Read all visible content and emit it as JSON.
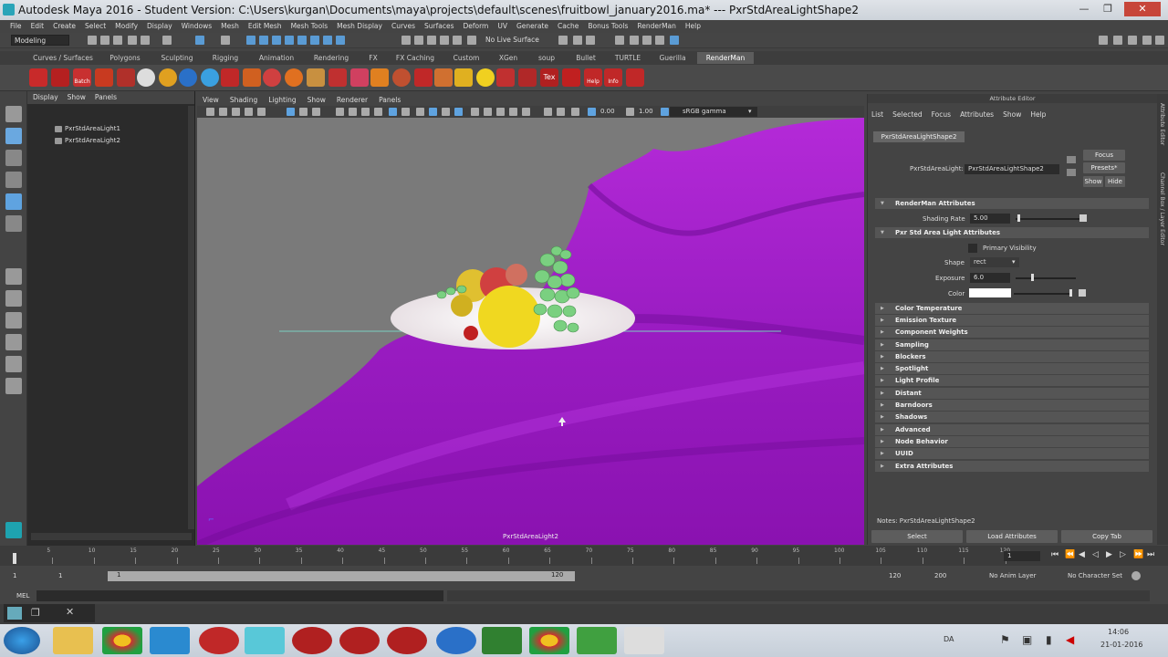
{
  "window": {
    "title": "Autodesk Maya 2016 - Student Version: C:\\Users\\kurgan\\Documents\\maya\\projects\\default\\scenes\\fruitbowl_january2016.ma*   ---   PxrStdAreaLightShape2",
    "minimize": "—",
    "restore": "❐",
    "close": "✕"
  },
  "menubar": [
    "File",
    "Edit",
    "Create",
    "Select",
    "Modify",
    "Display",
    "Windows",
    "Mesh",
    "Edit Mesh",
    "Mesh Tools",
    "Mesh Display",
    "Curves",
    "Surfaces",
    "Deform",
    "UV",
    "Generate",
    "Cache",
    "Bonus Tools",
    "RenderMan",
    "Help"
  ],
  "status": {
    "mode": "Modeling",
    "live_surface": "No Live Surface"
  },
  "shelf_tabs": [
    "Curves / Surfaces",
    "Polygons",
    "Sculpting",
    "Rigging",
    "Animation",
    "Rendering",
    "FX",
    "FX Caching",
    "Custom",
    "XGen",
    "soup",
    "Bullet",
    "TURTLE",
    "Guerilla",
    "RenderMan"
  ],
  "shelf_labels": {
    "batch": "Batch",
    "tex": "Tex",
    "help": "Help",
    "info": "Info"
  },
  "outliner": {
    "menu": [
      "Display",
      "Show",
      "Panels"
    ],
    "items": [
      "PxrStdAreaLight1",
      "PxrStdAreaLight2"
    ]
  },
  "viewport": {
    "menu": [
      "View",
      "Shading",
      "Lighting",
      "Show",
      "Renderer",
      "Panels"
    ],
    "exposure": "0.00",
    "gamma_value": "1.00",
    "colorspace": "sRGB gamma",
    "camera_label": "PxrStdAreaLight2"
  },
  "attribute_editor": {
    "title": "Attribute Editor",
    "menu": [
      "List",
      "Selected",
      "Focus",
      "Attributes",
      "Show",
      "Help"
    ],
    "node_tab": "PxrStdAreaLightShape2",
    "node_label": "PxrStdAreaLight:",
    "node_value": "PxrStdAreaLightShape2",
    "focus": "Focus",
    "presets": "Presets*",
    "show": "Show",
    "hide": "Hide",
    "renderman_section": "RenderMan Attributes",
    "shading_rate_label": "Shading Rate",
    "shading_rate": "5.00",
    "area_section": "Pxr  Std  Area  Light Attributes",
    "primary_visibility": "Primary Visibility",
    "shape_label": "Shape",
    "shape_value": "rect",
    "exposure_label": "Exposure",
    "exposure_value": "6.0",
    "color_label": "Color",
    "sections": [
      "Color Temperature",
      "Emission Texture",
      "Component Weights",
      "Sampling",
      "Blockers",
      "Spotlight",
      "Light Profile",
      "Distant",
      "Barndoors",
      "Shadows",
      "Advanced",
      "Node Behavior",
      "UUID",
      "Extra Attributes"
    ],
    "notes": "Notes:  PxrStdAreaLightShape2",
    "select": "Select",
    "load_attributes": "Load Attributes",
    "copy_tab": "Copy Tab"
  },
  "right_strip": {
    "attr": "Attribute Editor",
    "channel": "Channel Box / Layer Editor"
  },
  "timeline": {
    "ticks": [
      "5",
      "10",
      "15",
      "20",
      "25",
      "30",
      "35",
      "40",
      "45",
      "50",
      "55",
      "60",
      "65",
      "70",
      "75",
      "80",
      "85",
      "90",
      "95",
      "100",
      "105",
      "110",
      "115",
      "120"
    ],
    "current": "1"
  },
  "range": {
    "start": "1",
    "start2": "1",
    "inner_start": "1",
    "inner_end": "120",
    "end": "120",
    "end2": "200",
    "anim_layer": "No Anim Layer",
    "char_set": "No Character Set"
  },
  "cmd": {
    "mel": "MEL"
  },
  "taskbar": {
    "time": "14:06",
    "date": "21-01-2016",
    "lang": "DA"
  },
  "colors": {
    "accent": "#5fa3e0",
    "cloth": "#a020c8",
    "viewport_bg": "#7a7a7a"
  }
}
